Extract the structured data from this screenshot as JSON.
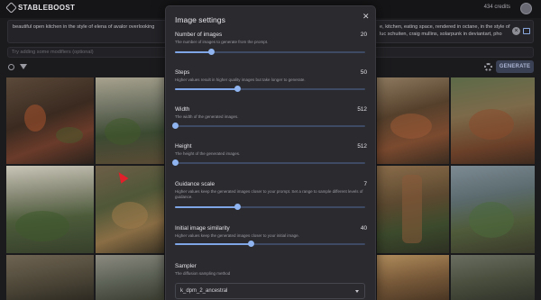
{
  "app": {
    "name": "STABLEBOOST",
    "credits": "434 credits"
  },
  "prompt": {
    "text_left": "beautiful open kitchen in the style of elena of avalor overlooking",
    "text_right": "e, kitchen, eating space, rendered in octane, in the style of luc schuiten, craig mullins, solarpunk in deviantart, pho"
  },
  "modifiers": {
    "placeholder": "Try adding some modifiers (optional)"
  },
  "toolbar": {
    "generate_label": "GENERATE"
  },
  "modal": {
    "title": "Image settings",
    "close": "✕",
    "settings": [
      {
        "label": "Number of images",
        "value": "20",
        "description": "The number of images to generate from the prompt.",
        "fraction": 0.19
      },
      {
        "label": "Steps",
        "value": "50",
        "description": "Higher values result in higher quality images but take longer to generate.",
        "fraction": 0.33
      },
      {
        "label": "Width",
        "value": "512",
        "description": "The width of the generated images.",
        "fraction": 0.0
      },
      {
        "label": "Height",
        "value": "512",
        "description": "The height of the generated images.",
        "fraction": 0.0
      },
      {
        "label": "Guidance scale",
        "value": "7",
        "description": "Higher values keep the generated images closer to your prompt. Set a range to sample different levels of guidance.",
        "fraction": 0.33
      },
      {
        "label": "Initial image similarity",
        "value": "40",
        "description": "Higher values keep the generated images closer to your initial image.",
        "fraction": 0.4
      }
    ],
    "sampler": {
      "label": "Sampler",
      "description": "The diffusion sampling method",
      "value": "k_dpm_2_ancestral"
    }
  },
  "colors": {
    "accent": "#7ea6e6",
    "modal_bg": "#2a2a2f",
    "page_bg": "#1b1b1e"
  }
}
